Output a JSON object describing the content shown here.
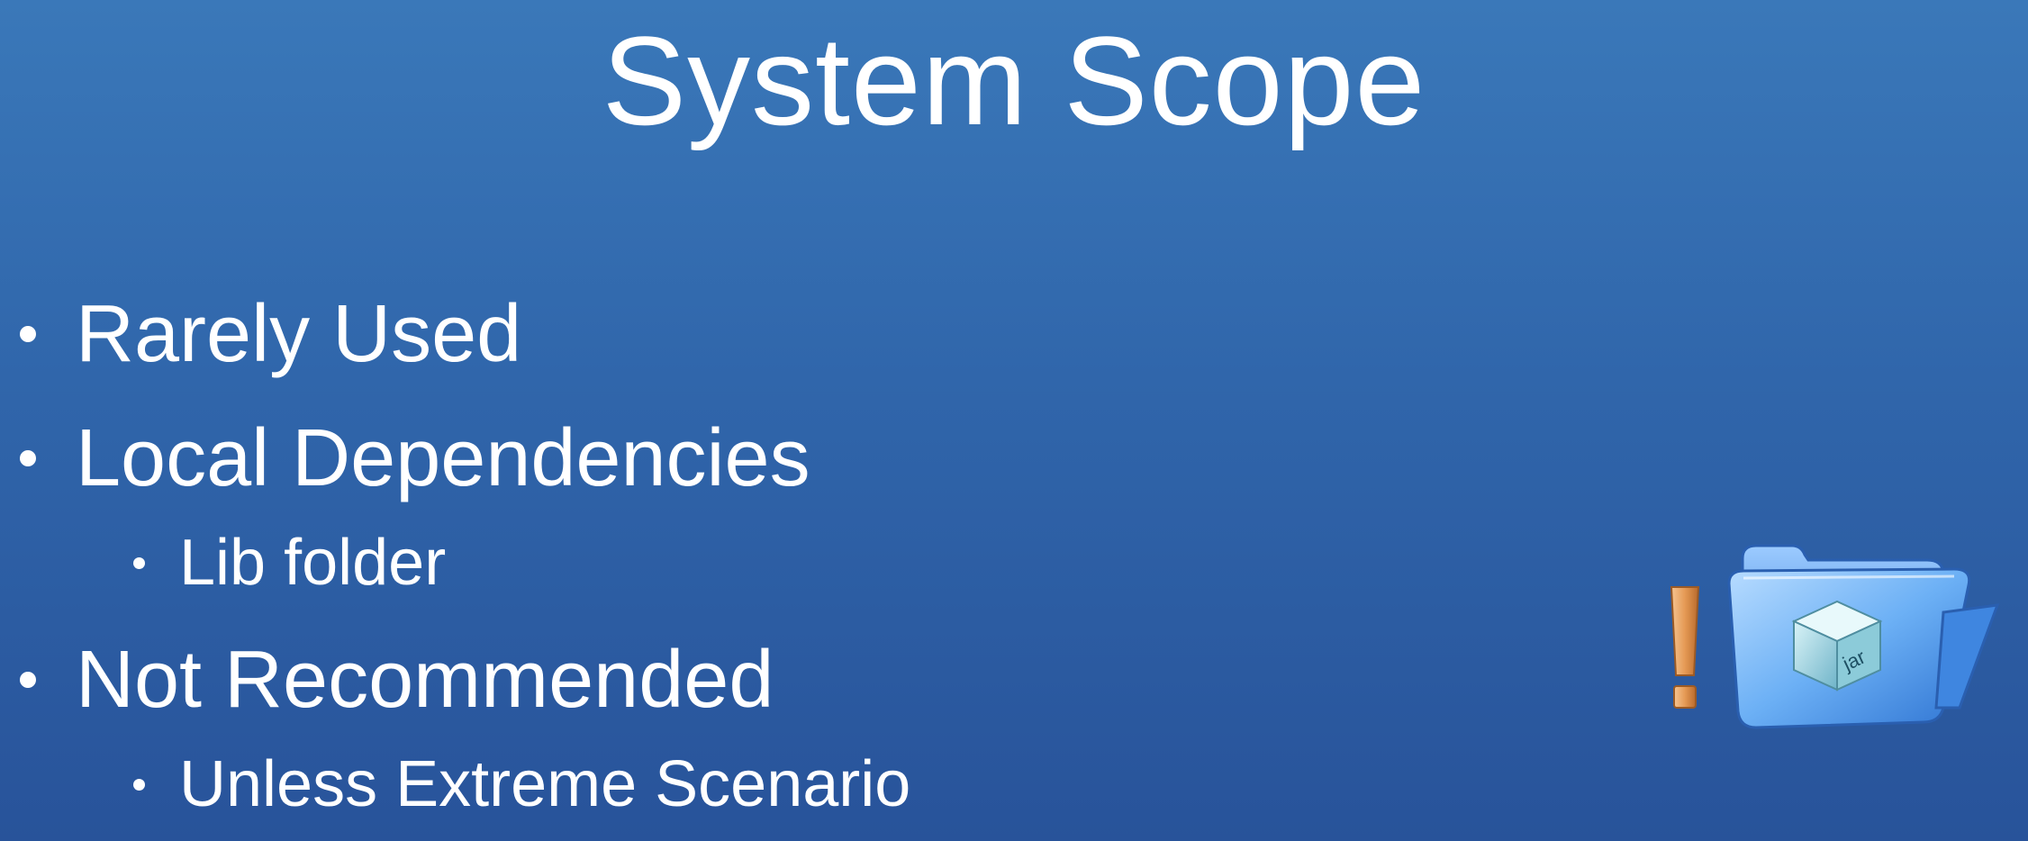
{
  "slide": {
    "title": "System Scope",
    "bullets": [
      {
        "level": 1,
        "text": "Rarely Used"
      },
      {
        "level": 1,
        "text": "Local Dependencies"
      },
      {
        "level": 2,
        "text": "Lib folder"
      },
      {
        "level": 1,
        "text": "Not Recommended"
      },
      {
        "level": 2,
        "text": "Unless Extreme Scenario"
      }
    ],
    "illustration": {
      "warning_icon": "exclamation-icon",
      "folder_icon": "folder-icon",
      "package_icon": "box-icon",
      "package_label": "jar"
    }
  },
  "colors": {
    "background_top": "#3a78b9",
    "background_bottom": "#28539a",
    "text": "#ffffff",
    "warning": "#e59a55",
    "folder": "#5aa2ee"
  }
}
